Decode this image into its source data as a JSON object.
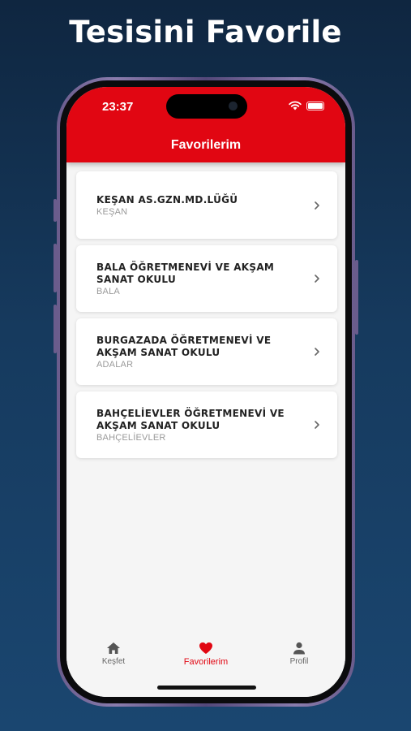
{
  "headline": "Tesisini Favorile",
  "status": {
    "time": "23:37"
  },
  "appbar": {
    "title": "Favorilerim"
  },
  "favorites": [
    {
      "title": "KEŞAN AS.GZN.MD.LÜĞÜ",
      "subtitle": "KEŞAN"
    },
    {
      "title": "BALA ÖĞRETMENEVİ VE AKŞAM SANAT OKULU",
      "subtitle": "BALA"
    },
    {
      "title": "BURGAZADA ÖĞRETMENEVİ VE AKŞAM SANAT OKULU",
      "subtitle": "ADALAR"
    },
    {
      "title": "BAHÇELİEVLER ÖĞRETMENEVİ VE AKŞAM SANAT OKULU",
      "subtitle": "BAHÇELİEVLER"
    }
  ],
  "tabs": [
    {
      "label": "Keşfet",
      "icon": "home-icon"
    },
    {
      "label": "Favorilerim",
      "icon": "heart-icon",
      "active": true
    },
    {
      "label": "Profil",
      "icon": "person-icon"
    }
  ],
  "colors": {
    "accent": "#e10612",
    "background": "#0f2640"
  }
}
